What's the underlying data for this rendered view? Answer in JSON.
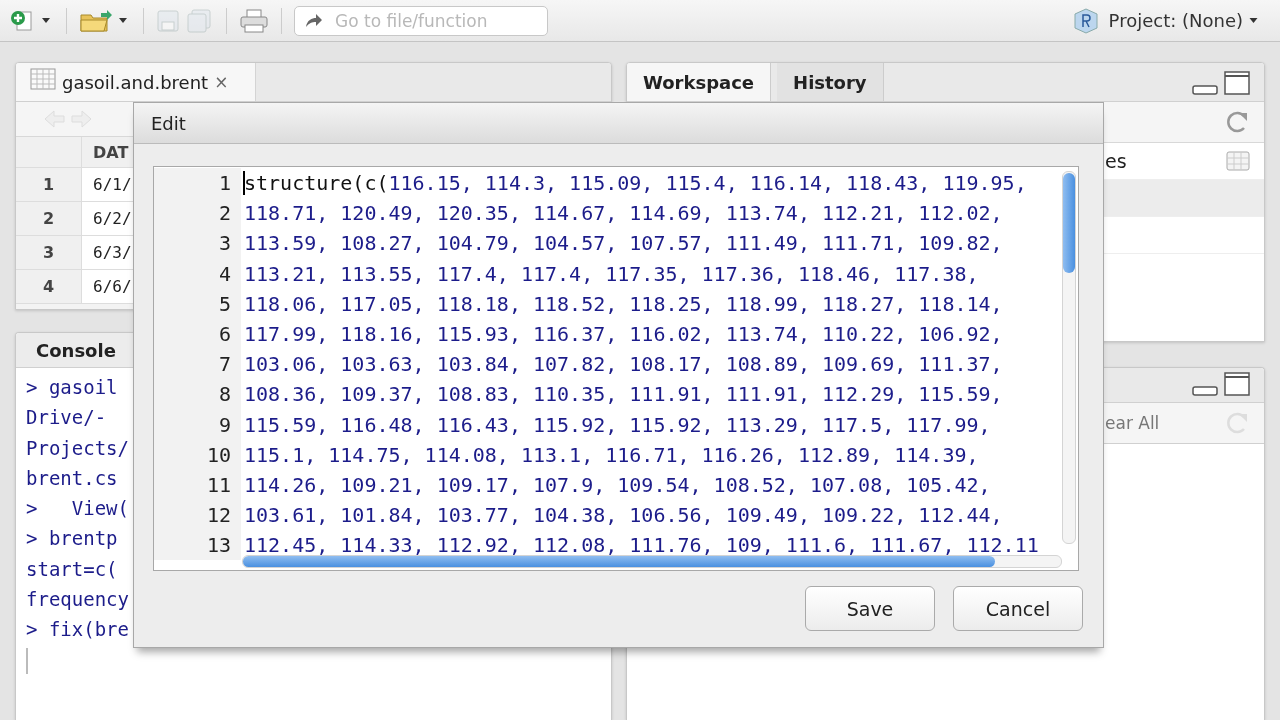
{
  "toolbar": {
    "goto_placeholder": "Go to file/function",
    "project": "Project: (None)"
  },
  "data_pane": {
    "tab": {
      "title": "gasoil.and.brent",
      "close": "×"
    },
    "column_1": "DAT",
    "rows": [
      {
        "number": "1",
        "cell": "6/1/"
      },
      {
        "number": "2",
        "cell": "6/2/"
      },
      {
        "number": "3",
        "cell": "6/3/"
      },
      {
        "number": "4",
        "cell": "6/6/"
      }
    ]
  },
  "console": {
    "title": "Console",
    "lines": [
      "> gasoil",
      "Drive/-",
      "Projects/",
      "brent.cs",
      ">   View(",
      "> brentp",
      "start=c(",
      "frequency",
      "> fix(bre"
    ]
  },
  "workspace_pane": {
    "tabs": [
      {
        "label": "Workspace",
        "selected": true
      },
      {
        "label": "History",
        "selected": false
      }
    ],
    "item": "es"
  },
  "lower_right_pane": {
    "toolbar_text": "ear All"
  },
  "dialog": {
    "title": "Edit",
    "lines": [
      {
        "number": "1",
        "text": "structure(c(116.15, 114.3, 115.09, 115.4, 116.14, 118.43, 119.95,",
        "cursor": true
      },
      {
        "number": "2",
        "text": "118.71, 120.49, 120.35, 114.67, 114.69, 113.74, 112.21, 112.02,",
        "cursor": false
      },
      {
        "number": "3",
        "text": "113.59, 108.27, 104.79, 104.57, 107.57, 111.49, 111.71, 109.82,",
        "cursor": false
      },
      {
        "number": "4",
        "text": "113.21, 113.55, 117.4, 117.4, 117.35, 117.36, 118.46, 117.38,",
        "cursor": false
      },
      {
        "number": "5",
        "text": "118.06, 117.05, 118.18, 118.52, 118.25, 118.99, 118.27, 118.14,",
        "cursor": false
      },
      {
        "number": "6",
        "text": "117.99, 118.16, 115.93, 116.37, 116.02, 113.74, 110.22, 106.92,",
        "cursor": false
      },
      {
        "number": "7",
        "text": "103.06, 103.63, 103.84, 107.82, 108.17, 108.89, 109.69, 111.37,",
        "cursor": false
      },
      {
        "number": "8",
        "text": "108.36, 109.37, 108.83, 110.35, 111.91, 111.91, 112.29, 115.59,",
        "cursor": false
      },
      {
        "number": "9",
        "text": "115.59, 116.48, 116.43, 115.92, 115.92, 113.29, 117.5, 117.99,",
        "cursor": false
      },
      {
        "number": "10",
        "text": "115.1, 114.75, 114.08, 113.1, 116.71, 116.26, 112.89, 114.39,",
        "cursor": false
      },
      {
        "number": "11",
        "text": "114.26, 109.21, 109.17, 107.9, 109.54, 108.52, 107.08, 105.42,",
        "cursor": false
      },
      {
        "number": "12",
        "text": "103.61, 101.84, 103.77, 104.38, 106.56, 109.49, 109.22, 112.44,",
        "cursor": false
      },
      {
        "number": "13",
        "text": "112.45, 114.33, 112.92, 112.08, 111.76, 109, 111.6, 111.67, 112.11",
        "cursor": false
      }
    ],
    "buttons": [
      "Save",
      "Cancel"
    ]
  }
}
